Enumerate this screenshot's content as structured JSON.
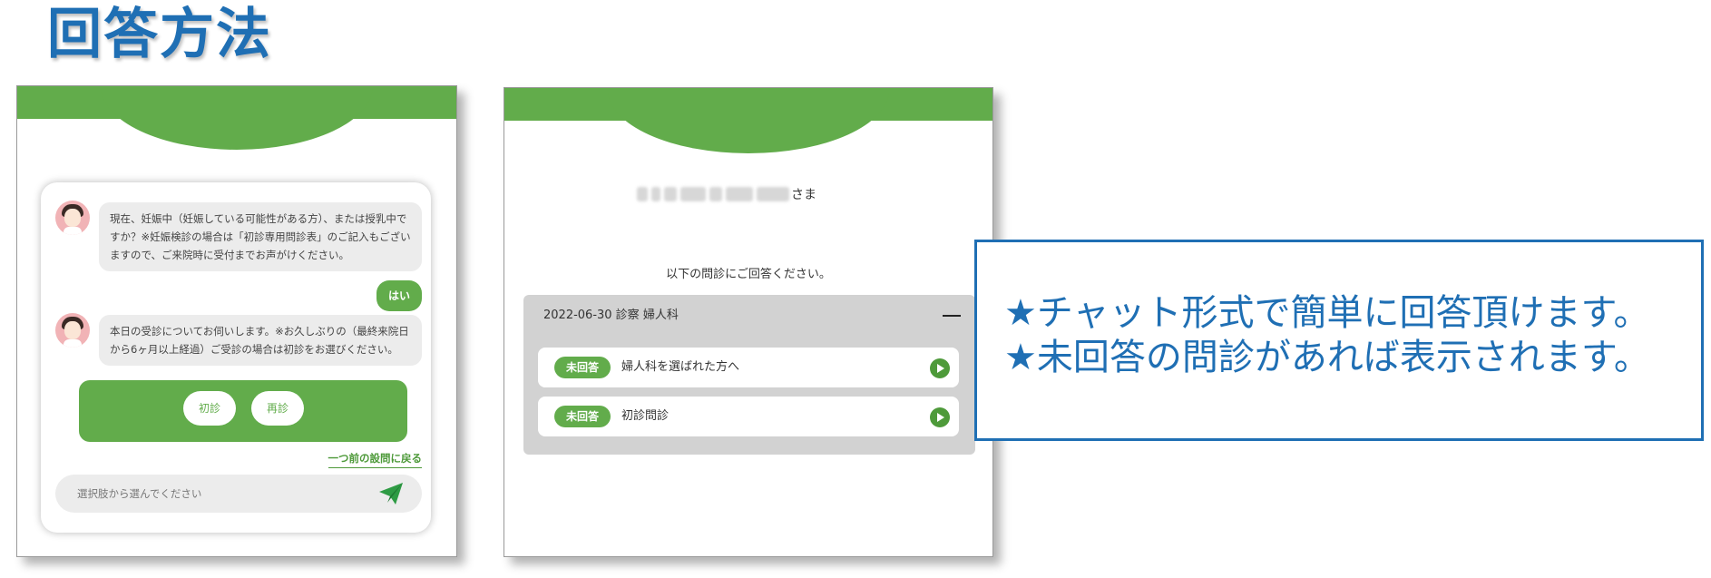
{
  "slide_title": "回答方法",
  "chat": {
    "messages": [
      {
        "from": "bot",
        "text": "現在、妊娠中（妊娠している可能性がある方）、または授乳中ですか？※妊娠検診の場合は「初診専用問診表」のご記入もございますので、ご来院時に受付までお声がけください。"
      },
      {
        "from": "user",
        "text": "はい"
      },
      {
        "from": "bot",
        "text": "本日の受診についてお伺いします。※お久しぶりの（最終来院日から6ヶ月以上経過）ご受診の場合は初診をお選びください。"
      }
    ],
    "choices": [
      "初診",
      "再診"
    ],
    "back_link": "一つ前の設問に戻る",
    "input_placeholder": "選択肢から選んでください",
    "icons": {
      "avatar": "operator-avatar-icon",
      "send": "paper-plane-send-icon"
    }
  },
  "questionnaire": {
    "name_suffix": "さま",
    "instruction": "以下の問診にご回答ください。",
    "group_header": "2022-06-30 診察 婦人科",
    "items": [
      {
        "status": "未回答",
        "label": "婦人科を選ばれた方へ"
      },
      {
        "status": "未回答",
        "label": "初診問診"
      }
    ],
    "icons": {
      "collapse": "minus-collapse-icon",
      "open": "play-arrow-icon"
    }
  },
  "callout": {
    "lines": [
      "★チャット形式で簡単に回答頂けます。",
      "★未回答の問診があれば表示されます。"
    ]
  },
  "colors": {
    "accent_green": "#62ac4b",
    "title_blue": "#1f6fb4",
    "panel_gray": "#d2d2d2"
  }
}
